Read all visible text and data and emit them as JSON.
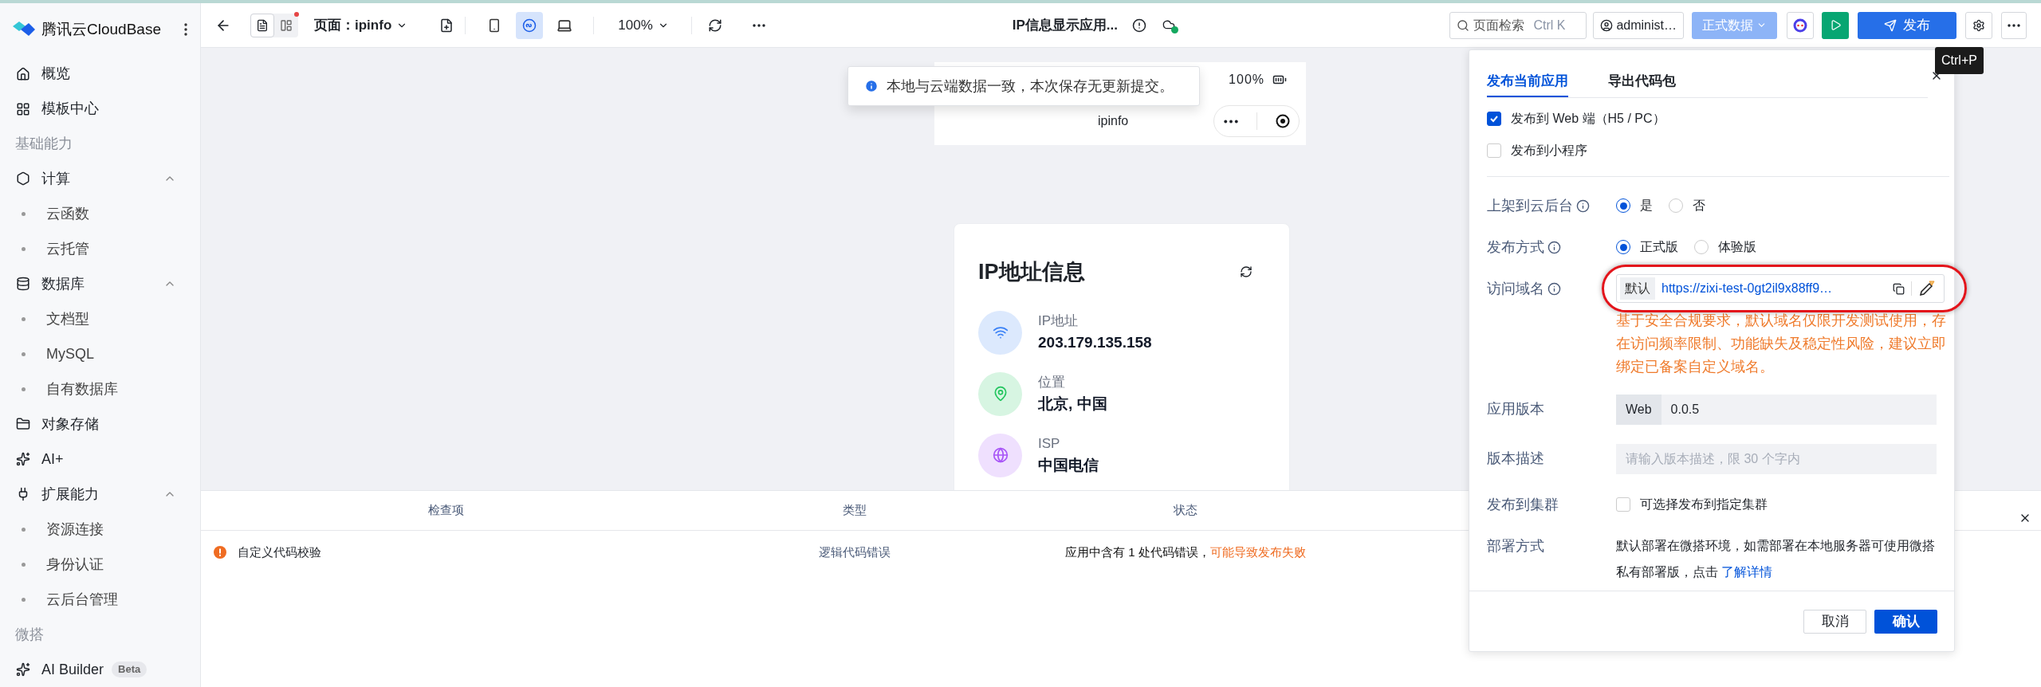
{
  "sidebar": {
    "brand": "腾讯云CloudBase",
    "nav": [
      {
        "kind": "link",
        "label": "概览"
      },
      {
        "kind": "link",
        "label": "模板中心"
      },
      {
        "kind": "heading",
        "label": "基础能力"
      },
      {
        "kind": "group",
        "label": "计算",
        "expanded": true,
        "children": [
          "云函数",
          "云托管"
        ]
      },
      {
        "kind": "group",
        "label": "数据库",
        "expanded": true,
        "children": [
          "文档型",
          "MySQL",
          "自有数据库"
        ]
      },
      {
        "kind": "link",
        "label": "对象存储"
      },
      {
        "kind": "link",
        "label": "AI+"
      },
      {
        "kind": "group",
        "label": "扩展能力",
        "expanded": true,
        "children": [
          "资源连接",
          "身份认证",
          "云后台管理"
        ]
      },
      {
        "kind": "heading",
        "label": "微搭"
      },
      {
        "kind": "link",
        "label": "AI Builder",
        "badge": "Beta"
      }
    ]
  },
  "toolbar": {
    "views": [
      {
        "selected": true,
        "dot": false
      },
      {
        "selected": false,
        "dot": true
      }
    ],
    "page": "页面：ipinfo",
    "devices": [
      {
        "selected": false
      },
      {
        "selected": true
      },
      {
        "selected": false
      }
    ],
    "zoom": "100%",
    "title": "IP信息显示应用...",
    "search": {
      "placeholder": "页面检索",
      "shortcut": "Ctrl K"
    },
    "user": "administ…",
    "data_env": "正式数据",
    "publish": "发布",
    "tooltip": "Ctrl+P"
  },
  "toast": "本地与云端数据一致，本次保存无更新提交。",
  "phone": {
    "battery": "100%",
    "title": "ipinfo",
    "card": {
      "title": "IP地址信息",
      "rows": [
        {
          "label": "IP地址",
          "value": "203.179.135.158",
          "color": "#3b82f6"
        },
        {
          "label": "位置",
          "value": "北京, 中国",
          "color": "#22c55e"
        },
        {
          "label": "ISP",
          "value": "中国电信",
          "color": "#a855f7"
        }
      ]
    }
  },
  "checks": {
    "columns": [
      "检查项",
      "类型",
      "状态"
    ],
    "rows": [
      {
        "item": "自定义代码校验",
        "type": "逻辑代码错误",
        "status": "应用中含有 1 处代码错误，",
        "warning": "可能导致发布失败"
      }
    ]
  },
  "publish_panel": {
    "tabs": [
      {
        "label": "发布当前应用",
        "selected": true
      },
      {
        "label": "导出代码包",
        "selected": false
      }
    ],
    "targets": [
      {
        "label": "发布到 Web 端（H5 / PC）",
        "checked": true
      },
      {
        "label": "发布到小程序",
        "checked": false
      }
    ],
    "fields": [
      {
        "kind": "radio",
        "label": "上架到云后台",
        "info": true,
        "options": [
          {
            "label": "是",
            "selected": true
          },
          {
            "label": "否",
            "selected": false
          }
        ]
      },
      {
        "kind": "radio",
        "label": "发布方式",
        "info": true,
        "options": [
          {
            "label": "正式版",
            "selected": true
          },
          {
            "label": "体验版",
            "selected": false
          }
        ]
      },
      {
        "kind": "domain",
        "label": "访问域名",
        "info": true,
        "tag": "默认",
        "url": "https://zixi-test-0gt2il9x88ff9…",
        "highlighted": true,
        "warning": "基于安全合规要求，默认域名仅限开发测试使用，存在访问频率限制、功能缺失及稳定性风险，建议立即绑定已备案自定义域名。"
      },
      {
        "kind": "version",
        "label": "应用版本",
        "tag": "Web",
        "value": "0.0.5"
      },
      {
        "kind": "input",
        "label": "版本描述",
        "placeholder": "请输入版本描述，限 30 个字内"
      },
      {
        "kind": "checkbox",
        "label": "发布到集群",
        "text": "可选择发布到指定集群",
        "checked": false
      },
      {
        "kind": "text",
        "label": "部署方式",
        "text": "默认部署在微搭环境，如需部署在本地服务器可使用微搭私有部署版，点击 ",
        "link": "了解详情"
      }
    ],
    "buttons": [
      {
        "label": "取消",
        "primary": false
      },
      {
        "label": "确认",
        "primary": true
      }
    ]
  }
}
